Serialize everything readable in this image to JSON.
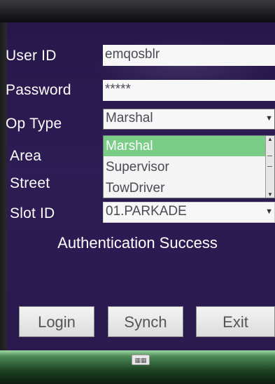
{
  "form": {
    "user_id": {
      "label": "User ID",
      "value": "emqosblr"
    },
    "password": {
      "label": "Password",
      "value": "*****"
    },
    "op_type": {
      "label": "Op Type",
      "value": "Marshal",
      "options": [
        "Marshal",
        "Supervisor",
        "TowDriver"
      ],
      "selected_index": 0
    },
    "area": {
      "label": "Area"
    },
    "street": {
      "label": "Street"
    },
    "slot_id": {
      "label": "Slot ID",
      "value": "01.PARKADE"
    }
  },
  "status": "Authentication Success",
  "buttons": {
    "login": "Login",
    "synch": "Synch",
    "exit": "Exit"
  },
  "colors": {
    "screen_bg": "#2a1a4d",
    "selected_option": "#79cd86",
    "field_bg": "#f7f7f7"
  },
  "icons": {
    "dropdown": "chevron-down-icon",
    "taskbar": "keyboard-icon"
  }
}
